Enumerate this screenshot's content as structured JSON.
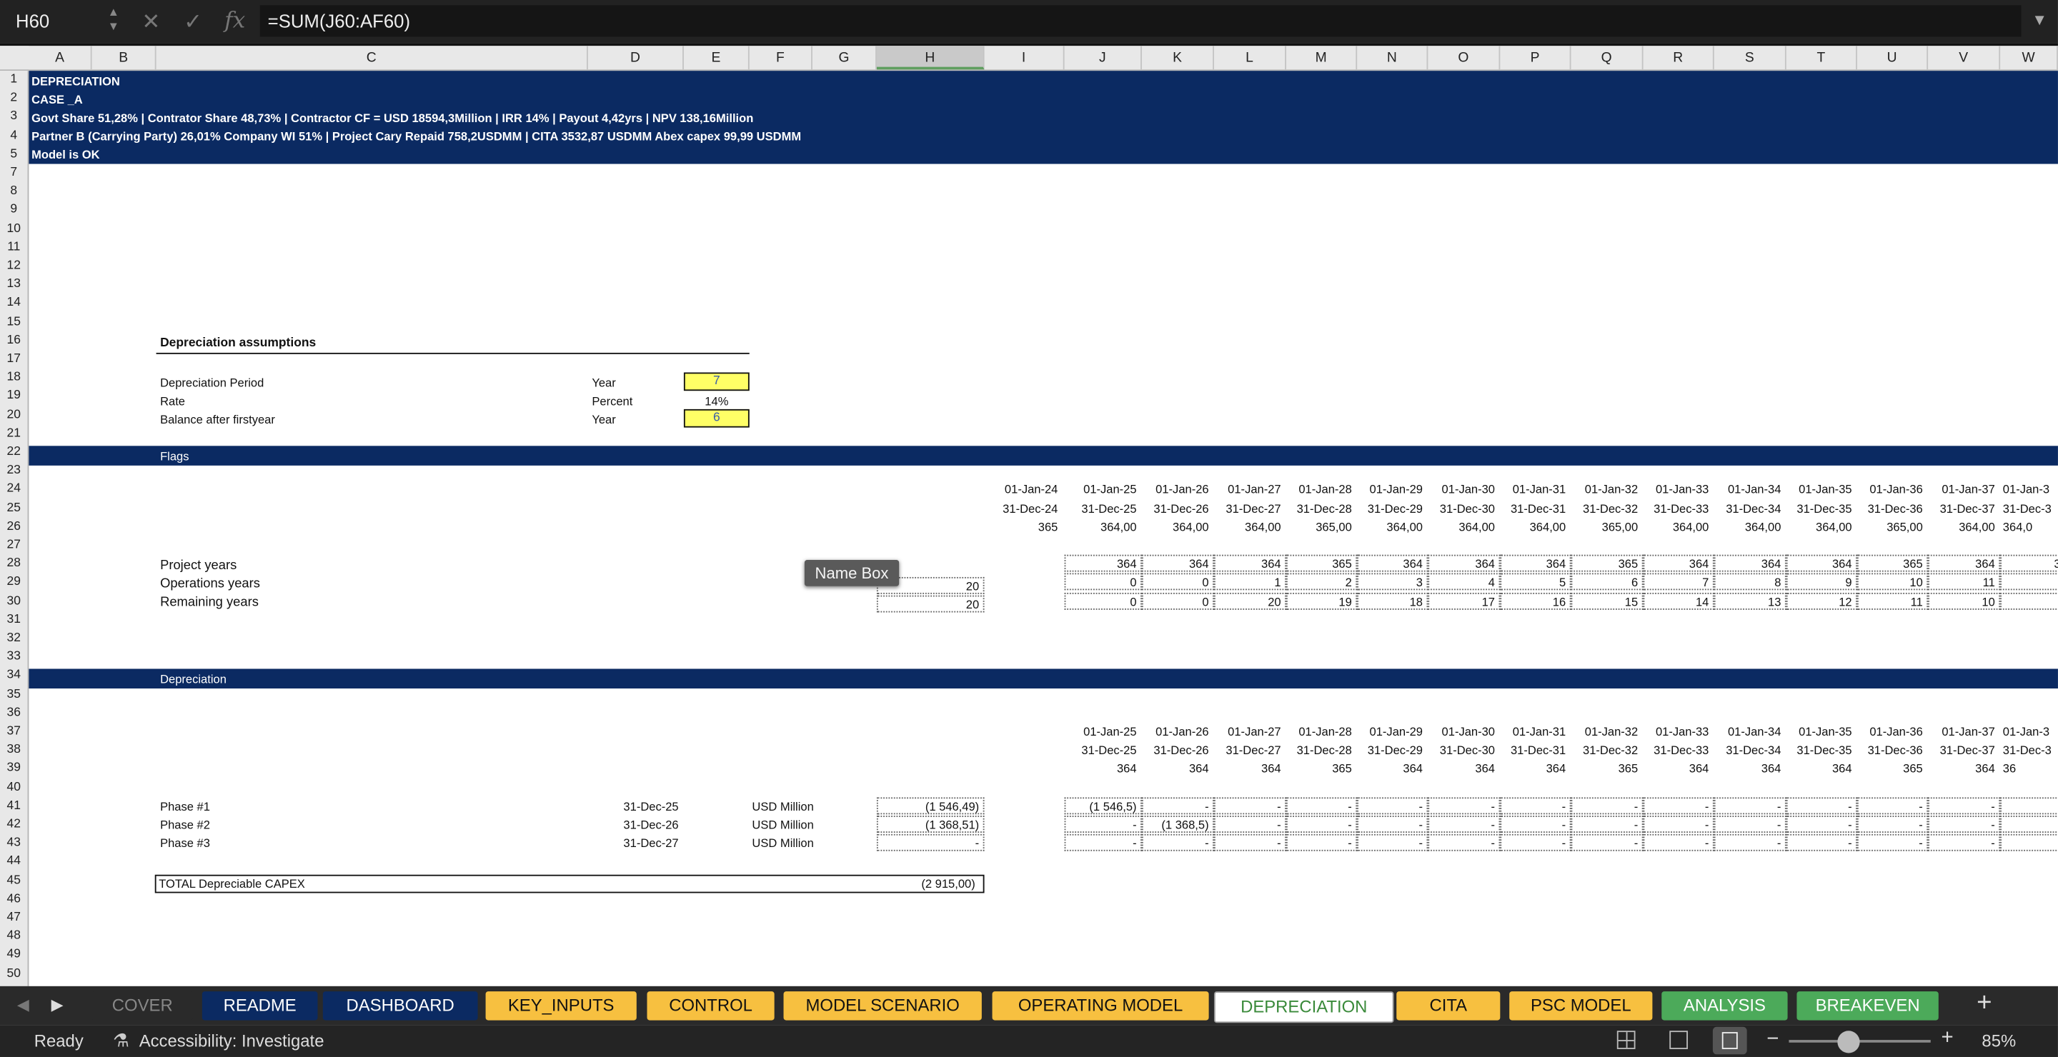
{
  "formula_bar": {
    "cell_ref": "H60",
    "formula": "=SUM(J60:AF60)",
    "cancel_icon": "✕",
    "enter_icon": "✓",
    "fx_icon": "fx"
  },
  "columns": [
    "A",
    "B",
    "C",
    "D",
    "E",
    "F",
    "G",
    "H",
    "I",
    "J",
    "K",
    "L",
    "M",
    "N",
    "O",
    "P",
    "Q",
    "R",
    "S",
    "T",
    "U",
    "V",
    "W"
  ],
  "selected_column": "H",
  "rows": [
    "1",
    "2",
    "3",
    "4",
    "5",
    "7",
    "8",
    "9",
    "10",
    "11",
    "12",
    "13",
    "14",
    "15",
    "16",
    "17",
    "18",
    "19",
    "20",
    "21",
    "22",
    "23",
    "24",
    "25",
    "26",
    "27",
    "28",
    "29",
    "30",
    "31",
    "32",
    "33",
    "34",
    "35",
    "36",
    "37",
    "38",
    "39",
    "40",
    "41",
    "42",
    "43",
    "44",
    "45",
    "46",
    "47",
    "48",
    "49",
    "50"
  ],
  "header_block": {
    "line1": "DEPRECIATION",
    "line2": "CASE _A",
    "line3": "Govt Share 51,28% | Contrator Share 48,73% |  Contractor CF = USD 18594,3Million | IRR 14% | Payout 4,42yrs | NPV 138,16Million",
    "line4": "Partner B (Carrying Party) 26,01% Company WI 51% |  Project Cary Repaid  758,2USDMM  |  CITA 3532,87  USDMM Abex capex 99,99  USDMM",
    "line5": "Model is OK"
  },
  "assumptions": {
    "title": "Depreciation  assumptions",
    "period_label": "Depreciation Period",
    "period_unit": "Year",
    "period_value": "7",
    "rate_label": "Rate",
    "rate_unit": "Percent",
    "rate_value": "14%",
    "balance_label": "Balance after firstyear",
    "balance_unit": "Year",
    "balance_value": "6"
  },
  "flags": {
    "band_title": "Flags",
    "start_dates": [
      "01-Jan-24",
      "01-Jan-25",
      "01-Jan-26",
      "01-Jan-27",
      "01-Jan-28",
      "01-Jan-29",
      "01-Jan-30",
      "01-Jan-31",
      "01-Jan-32",
      "01-Jan-33",
      "01-Jan-34",
      "01-Jan-35",
      "01-Jan-36",
      "01-Jan-37",
      "01-Jan-3"
    ],
    "end_dates": [
      "31-Dec-24",
      "31-Dec-25",
      "31-Dec-26",
      "31-Dec-27",
      "31-Dec-28",
      "31-Dec-29",
      "31-Dec-30",
      "31-Dec-31",
      "31-Dec-32",
      "31-Dec-33",
      "31-Dec-34",
      "31-Dec-35",
      "31-Dec-36",
      "31-Dec-37",
      "31-Dec-3"
    ],
    "days": [
      "365",
      "364,00",
      "364,00",
      "364,00",
      "365,00",
      "364,00",
      "364,00",
      "364,00",
      "365,00",
      "364,00",
      "364,00",
      "364,00",
      "365,00",
      "364,00",
      "364,0"
    ],
    "project_years": {
      "label": "Project years",
      "values": [
        "364",
        "364",
        "364",
        "365",
        "364",
        "364",
        "364",
        "365",
        "364",
        "364",
        "364",
        "365",
        "364",
        "36"
      ]
    },
    "operations_years": {
      "label": "Operations years",
      "total": "20",
      "values": [
        "0",
        "0",
        "1",
        "2",
        "3",
        "4",
        "5",
        "6",
        "7",
        "8",
        "9",
        "10",
        "11",
        ""
      ]
    },
    "remaining_years": {
      "label": "Remaining  years",
      "total": "20",
      "values": [
        "0",
        "0",
        "20",
        "19",
        "18",
        "17",
        "16",
        "15",
        "14",
        "13",
        "12",
        "11",
        "10",
        ""
      ]
    }
  },
  "depreciation": {
    "band_title": "Depreciation",
    "start_dates": [
      "01-Jan-25",
      "01-Jan-26",
      "01-Jan-27",
      "01-Jan-28",
      "01-Jan-29",
      "01-Jan-30",
      "01-Jan-31",
      "01-Jan-32",
      "01-Jan-33",
      "01-Jan-34",
      "01-Jan-35",
      "01-Jan-36",
      "01-Jan-37",
      "01-Jan-3"
    ],
    "end_dates": [
      "31-Dec-25",
      "31-Dec-26",
      "31-Dec-27",
      "31-Dec-28",
      "31-Dec-29",
      "31-Dec-30",
      "31-Dec-31",
      "31-Dec-32",
      "31-Dec-33",
      "31-Dec-34",
      "31-Dec-35",
      "31-Dec-36",
      "31-Dec-37",
      "31-Dec-3"
    ],
    "days": [
      "364",
      "364",
      "364",
      "365",
      "364",
      "364",
      "364",
      "365",
      "364",
      "364",
      "364",
      "365",
      "364",
      "36"
    ],
    "phases": [
      {
        "label": "Phase #1",
        "date": "31-Dec-25",
        "unit": "USD Million",
        "total": "(1 546,49)",
        "values": [
          "(1 546,5)",
          "-",
          "-",
          "-",
          "-",
          "-",
          "-",
          "-",
          "-",
          "-",
          "-",
          "-",
          "-",
          ""
        ]
      },
      {
        "label": "Phase #2",
        "date": "31-Dec-26",
        "unit": "USD Million",
        "total": "(1 368,51)",
        "values": [
          "-",
          "(1 368,5)",
          "-",
          "-",
          "-",
          "-",
          "-",
          "-",
          "-",
          "-",
          "-",
          "-",
          "-",
          ""
        ]
      },
      {
        "label": "Phase #3",
        "date": "31-Dec-27",
        "unit": "USD Million",
        "total": "-",
        "values": [
          "-",
          "-",
          "-",
          "-",
          "-",
          "-",
          "-",
          "-",
          "-",
          "-",
          "-",
          "-",
          "-",
          ""
        ]
      }
    ],
    "total_label": "TOTAL Depreciable CAPEX",
    "total_value": "(2 915,00)"
  },
  "tooltip": "Name Box",
  "sheet_tabs": [
    {
      "label": "COVER",
      "style": "grey"
    },
    {
      "label": "README",
      "style": "navy"
    },
    {
      "label": "DASHBOARD",
      "style": "navy"
    },
    {
      "label": "KEY_INPUTS",
      "style": "orange"
    },
    {
      "label": "CONTROL",
      "style": "orange"
    },
    {
      "label": "MODEL SCENARIO",
      "style": "orange"
    },
    {
      "label": "OPERATING MODEL",
      "style": "orange"
    },
    {
      "label": "DEPRECIATION",
      "style": "active"
    },
    {
      "label": "CITA",
      "style": "orange"
    },
    {
      "label": "PSC MODEL",
      "style": "orange"
    },
    {
      "label": "ANALYSIS",
      "style": "green"
    },
    {
      "label": "BREAKEVEN",
      "style": "green"
    }
  ],
  "add_sheet": "+",
  "status_bar": {
    "ready": "Ready",
    "accessibility": "Accessibility: Investigate",
    "zoom": "85%",
    "zoom_minus": "−",
    "zoom_plus": "+"
  },
  "colors": {
    "band": "#0b2a62",
    "input_yellow": "#ffff66",
    "tab_orange": "#f7c040",
    "tab_green": "#4caa5a"
  }
}
